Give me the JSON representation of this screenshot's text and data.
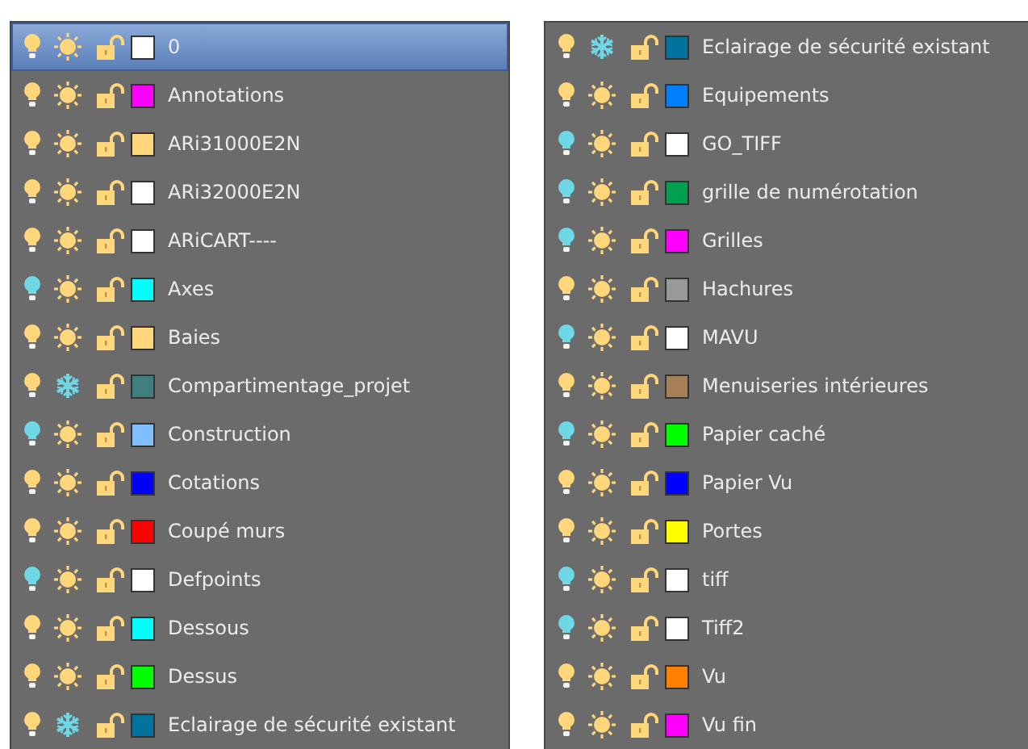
{
  "panels": [
    {
      "layers": [
        {
          "name": "0",
          "on": true,
          "frozen": false,
          "locked": false,
          "color": "#ffffff",
          "selected": true
        },
        {
          "name": "Annotations",
          "on": true,
          "frozen": false,
          "locked": false,
          "color": "#ff00ff",
          "selected": false
        },
        {
          "name": "ARi31000E2N",
          "on": true,
          "frozen": false,
          "locked": false,
          "color": "#ffd67a",
          "selected": false
        },
        {
          "name": "ARi32000E2N",
          "on": true,
          "frozen": false,
          "locked": false,
          "color": "#ffffff",
          "selected": false
        },
        {
          "name": "ARiCART----",
          "on": true,
          "frozen": false,
          "locked": false,
          "color": "#ffffff",
          "selected": false
        },
        {
          "name": "Axes",
          "on": false,
          "frozen": false,
          "locked": false,
          "color": "#00ffff",
          "selected": false
        },
        {
          "name": "Baies",
          "on": true,
          "frozen": false,
          "locked": false,
          "color": "#ffd67a",
          "selected": false
        },
        {
          "name": "Compartimentage_projet",
          "on": true,
          "frozen": true,
          "locked": false,
          "color": "#3f7f7f",
          "selected": false
        },
        {
          "name": "Construction",
          "on": false,
          "frozen": false,
          "locked": false,
          "color": "#7fbfff",
          "selected": false
        },
        {
          "name": "Cotations",
          "on": true,
          "frozen": false,
          "locked": false,
          "color": "#0000ff",
          "selected": false
        },
        {
          "name": "Coupé murs",
          "on": true,
          "frozen": false,
          "locked": false,
          "color": "#ff0000",
          "selected": false
        },
        {
          "name": "Defpoints",
          "on": false,
          "frozen": false,
          "locked": false,
          "color": "#ffffff",
          "selected": false
        },
        {
          "name": "Dessous",
          "on": true,
          "frozen": false,
          "locked": false,
          "color": "#00ffff",
          "selected": false
        },
        {
          "name": "Dessus",
          "on": true,
          "frozen": false,
          "locked": false,
          "color": "#00ff00",
          "selected": false
        },
        {
          "name": "Eclairage de sécurité existant",
          "on": true,
          "frozen": true,
          "locked": false,
          "color": "#00739f",
          "selected": false
        }
      ]
    },
    {
      "layers": [
        {
          "name": "Eclairage de sécurité existant",
          "on": true,
          "frozen": true,
          "locked": false,
          "color": "#00739f",
          "selected": false
        },
        {
          "name": "Equipements",
          "on": true,
          "frozen": false,
          "locked": false,
          "color": "#007fff",
          "selected": false
        },
        {
          "name": "GO_TIFF",
          "on": false,
          "frozen": false,
          "locked": false,
          "color": "#ffffff",
          "selected": false
        },
        {
          "name": "grille de numérotation",
          "on": false,
          "frozen": false,
          "locked": false,
          "color": "#00a050",
          "selected": false
        },
        {
          "name": "Grilles",
          "on": false,
          "frozen": false,
          "locked": false,
          "color": "#ff00ff",
          "selected": false
        },
        {
          "name": "Hachures",
          "on": true,
          "frozen": false,
          "locked": false,
          "color": "#999999",
          "selected": false
        },
        {
          "name": "MAVU",
          "on": false,
          "frozen": false,
          "locked": false,
          "color": "#ffffff",
          "selected": false
        },
        {
          "name": "Menuiseries intérieures",
          "on": true,
          "frozen": false,
          "locked": false,
          "color": "#a57f56",
          "selected": false
        },
        {
          "name": "Papier caché",
          "on": false,
          "frozen": false,
          "locked": false,
          "color": "#00ff00",
          "selected": false
        },
        {
          "name": "Papier Vu",
          "on": true,
          "frozen": false,
          "locked": false,
          "color": "#0000ff",
          "selected": false
        },
        {
          "name": "Portes",
          "on": true,
          "frozen": false,
          "locked": false,
          "color": "#ffff00",
          "selected": false
        },
        {
          "name": "tiff",
          "on": false,
          "frozen": false,
          "locked": false,
          "color": "#ffffff",
          "selected": false
        },
        {
          "name": "Tiff2",
          "on": false,
          "frozen": false,
          "locked": false,
          "color": "#ffffff",
          "selected": false
        },
        {
          "name": "Vu",
          "on": true,
          "frozen": false,
          "locked": false,
          "color": "#ff7f00",
          "selected": false
        },
        {
          "name": "Vu fin",
          "on": true,
          "frozen": false,
          "locked": false,
          "color": "#ff00ff",
          "selected": false
        }
      ]
    }
  ]
}
